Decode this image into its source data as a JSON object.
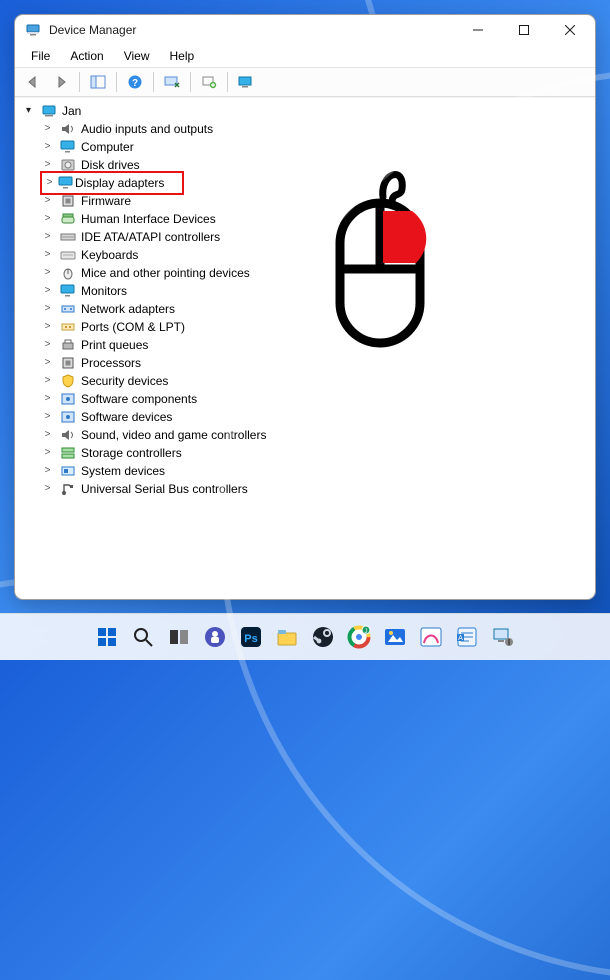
{
  "window": {
    "title": "Device Manager"
  },
  "menu": {
    "file": "File",
    "action": "Action",
    "view": "View",
    "help": "Help"
  },
  "root": {
    "name": "Jan"
  },
  "categories": [
    {
      "label": "Audio inputs and outputs",
      "icon": "speaker"
    },
    {
      "label": "Computer",
      "icon": "monitor"
    },
    {
      "label": "Disk drives",
      "icon": "disk"
    },
    {
      "label": "Display adapters",
      "icon": "monitor",
      "highlight": true
    },
    {
      "label": "Firmware",
      "icon": "chip"
    },
    {
      "label": "Human Interface Devices",
      "icon": "hid"
    },
    {
      "label": "IDE ATA/ATAPI controllers",
      "icon": "ide"
    },
    {
      "label": "Keyboards",
      "icon": "keyboard"
    },
    {
      "label": "Mice and other pointing devices",
      "icon": "mouse"
    },
    {
      "label": "Monitors",
      "icon": "monitor"
    },
    {
      "label": "Network adapters",
      "icon": "net"
    },
    {
      "label": "Ports (COM & LPT)",
      "icon": "port"
    },
    {
      "label": "Print queues",
      "icon": "printer"
    },
    {
      "label": "Processors",
      "icon": "cpu"
    },
    {
      "label": "Security devices",
      "icon": "security"
    },
    {
      "label": "Software components",
      "icon": "sw"
    },
    {
      "label": "Software devices",
      "icon": "sw"
    },
    {
      "label": "Sound, video and game controllers",
      "icon": "speaker"
    },
    {
      "label": "Storage controllers",
      "icon": "storage"
    },
    {
      "label": "System devices",
      "icon": "system"
    },
    {
      "label": "Universal Serial Bus controllers",
      "icon": "usb"
    }
  ],
  "taskbar": [
    "start",
    "search",
    "taskview",
    "teams",
    "ps",
    "explorer",
    "steam",
    "chrome",
    "photos",
    "paint",
    "word",
    "devmgr"
  ]
}
